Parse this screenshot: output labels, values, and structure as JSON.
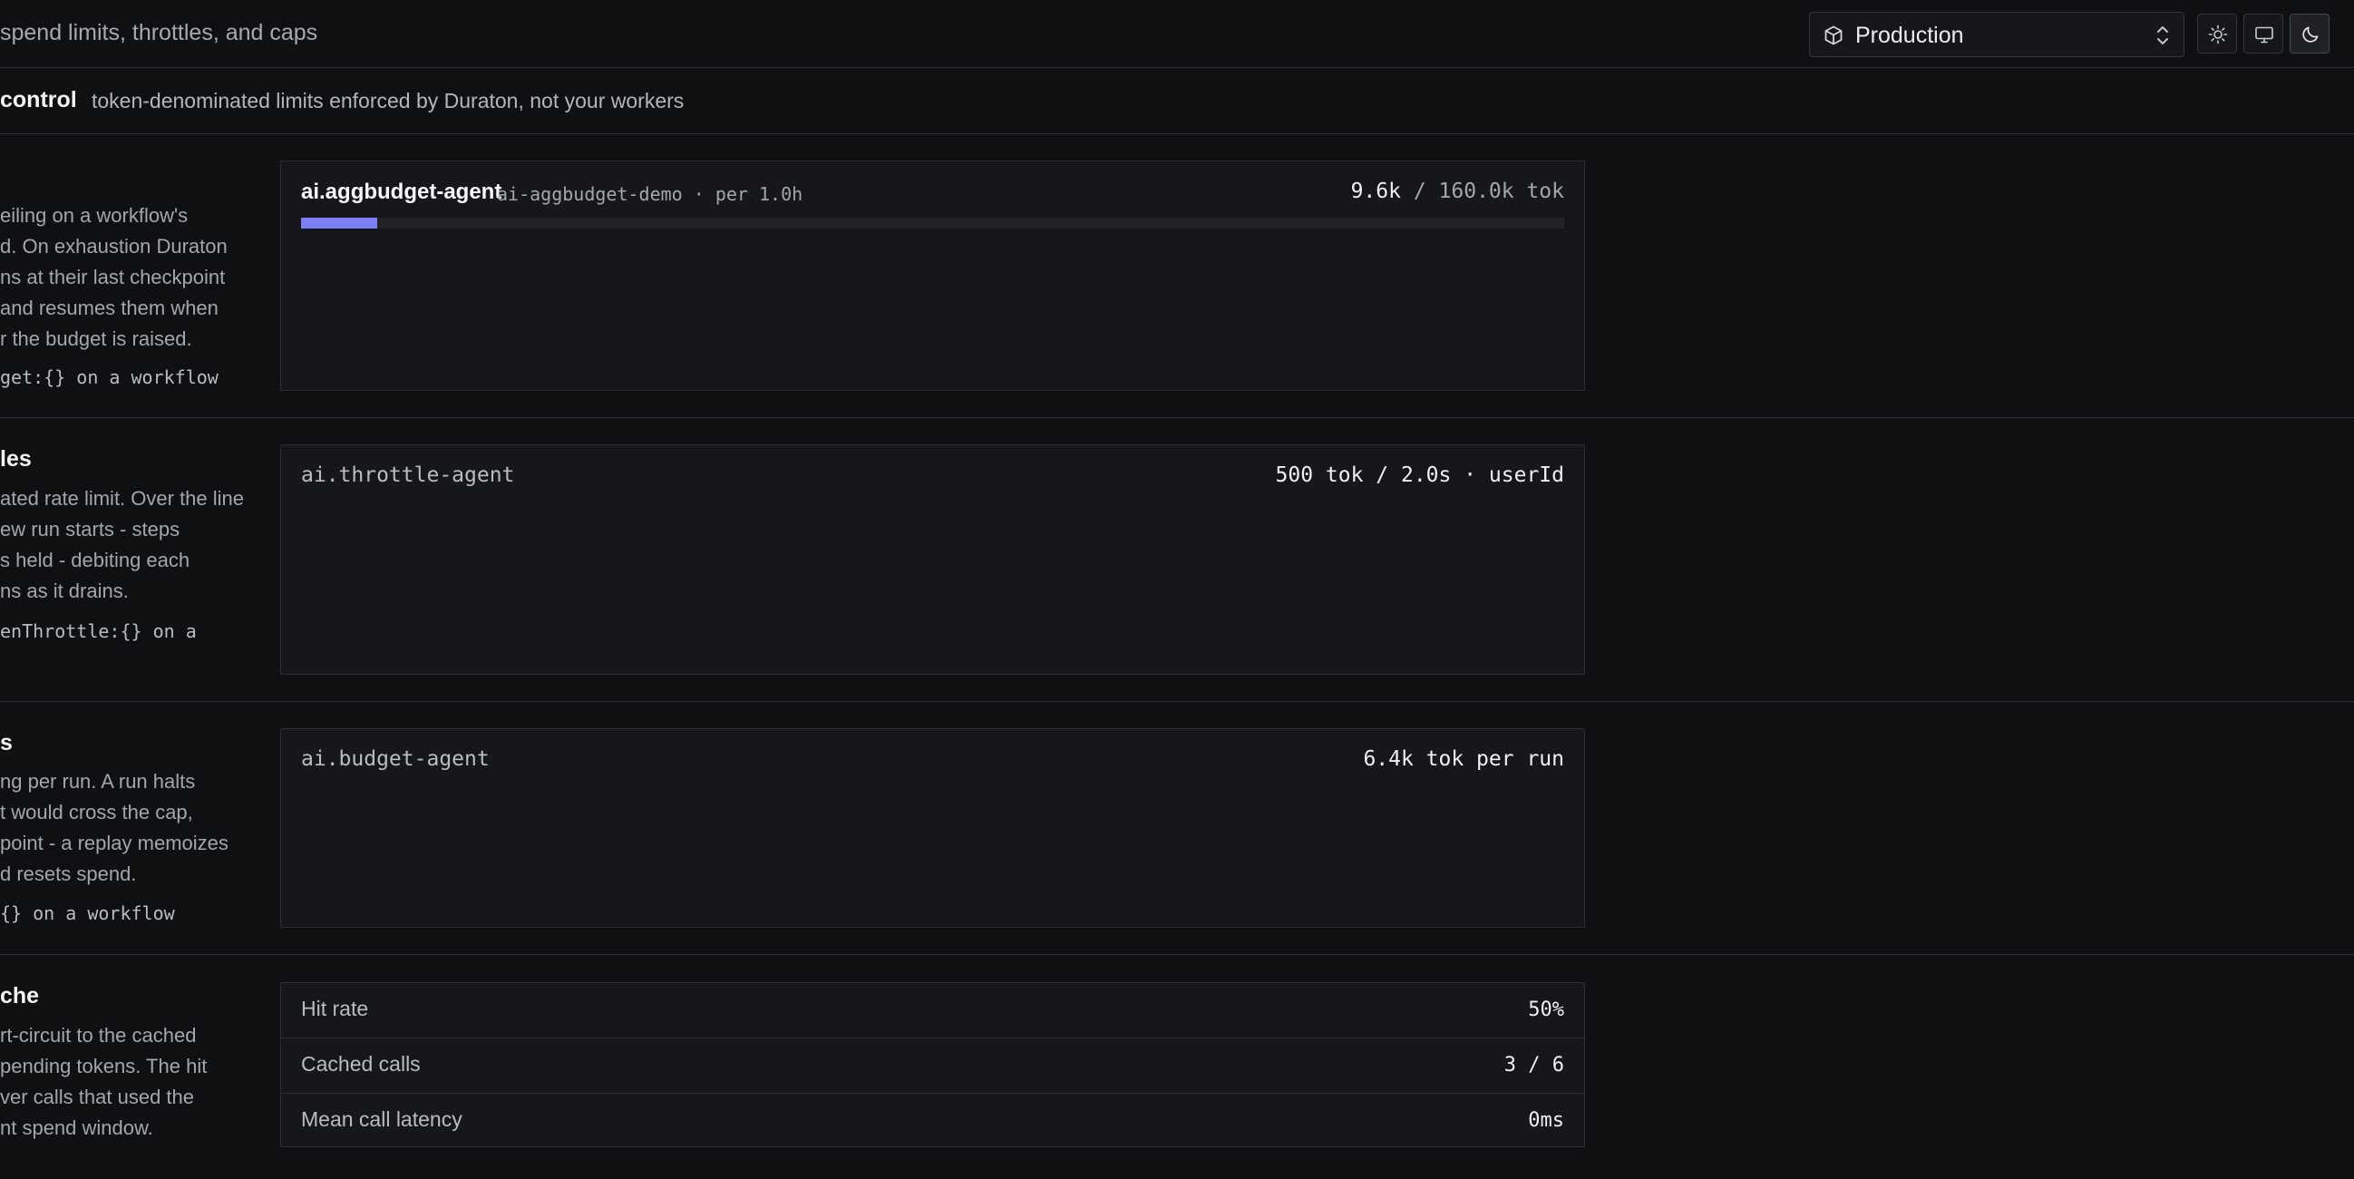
{
  "topbar": {
    "subtitle": "spend limits, throttles, and caps",
    "environment": {
      "selected": "Production",
      "icon": "cube-icon"
    },
    "theme_buttons": [
      {
        "name": "light-theme-button",
        "icon": "sun-icon"
      },
      {
        "name": "system-theme-button",
        "icon": "monitor-icon"
      },
      {
        "name": "dark-theme-button",
        "icon": "moon-icon",
        "active": true
      }
    ]
  },
  "section": {
    "title": "control",
    "description": "token-denominated limits enforced by Duraton, not your workers"
  },
  "rows": {
    "aggbudget": {
      "left_lines": [
        "eiling on a workflow's",
        "d. On exhaustion Duraton",
        "ns at their last checkpoint",
        "and resumes them when",
        "r the budget is raised."
      ],
      "left_code": "get:{} on a workflow",
      "card": {
        "name": "ai.aggbudget-agent",
        "meta": "ai-aggbudget-demo · per 1.0h",
        "used": "9.6k",
        "limit": "/ 160.0k tok",
        "progress_fraction": 0.06,
        "accent": "#7c7ff2"
      }
    },
    "throttles": {
      "title": "les",
      "left_lines": [
        "ated rate limit. Over the line",
        "ew run starts - steps",
        "s held - debiting each",
        "ns as it drains."
      ],
      "left_code": "enThrottle:{} on a",
      "card": {
        "name": "ai.throttle-agent",
        "value": "500 tok / 2.0s · userId"
      }
    },
    "caps": {
      "title": "s",
      "left_lines": [
        "ng per run. A run halts",
        "t would cross the cap,",
        "point - a replay memoizes",
        "d resets spend."
      ],
      "left_code": "{} on a workflow",
      "card": {
        "name": "ai.budget-agent",
        "value": "6.4k tok per run"
      }
    },
    "cache": {
      "title": "che",
      "left_lines": [
        "rt-circuit to the cached",
        "pending tokens. The hit",
        "ver calls that used the",
        "nt spend window."
      ],
      "table": [
        {
          "label": "Hit rate",
          "value": "50%"
        },
        {
          "label": "Cached calls",
          "value": "3 / 6"
        },
        {
          "label": "Mean call latency",
          "value": "0ms"
        }
      ]
    }
  }
}
